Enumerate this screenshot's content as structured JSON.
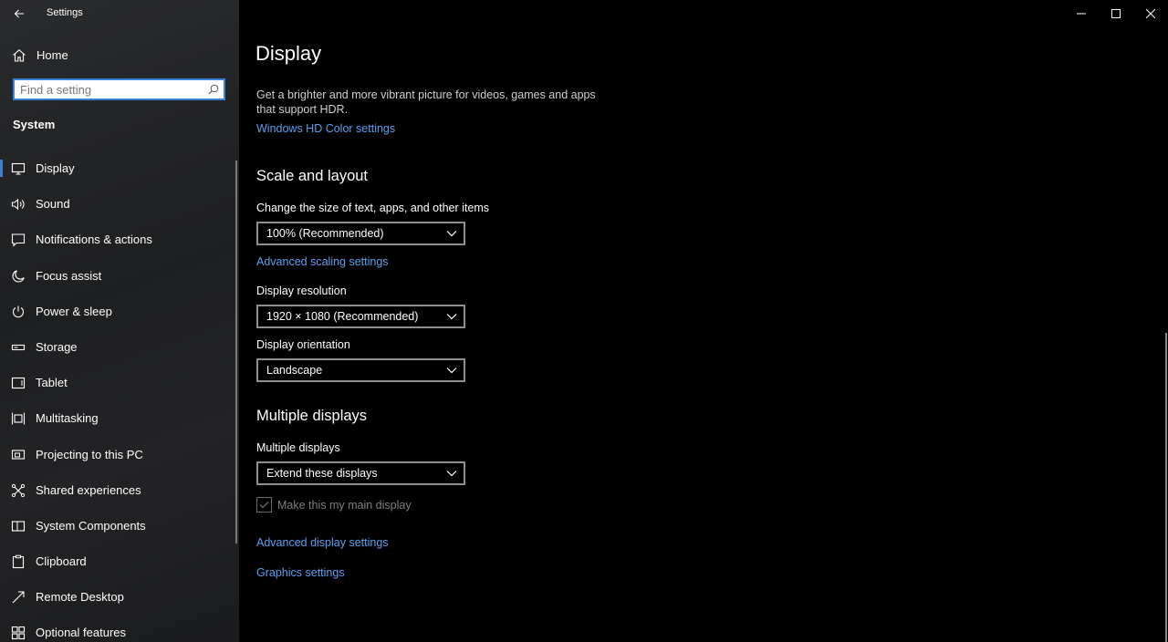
{
  "app_title": "Settings",
  "sidebar": {
    "home_label": "Home",
    "search_placeholder": "Find a setting",
    "section_heading": "System",
    "items": [
      {
        "label": "Display",
        "icon": "monitor-icon",
        "active": true
      },
      {
        "label": "Sound",
        "icon": "speaker-icon"
      },
      {
        "label": "Notifications & actions",
        "icon": "notification-icon"
      },
      {
        "label": "Focus assist",
        "icon": "moon-icon"
      },
      {
        "label": "Power & sleep",
        "icon": "power-icon"
      },
      {
        "label": "Storage",
        "icon": "storage-icon"
      },
      {
        "label": "Tablet",
        "icon": "tablet-icon"
      },
      {
        "label": "Multitasking",
        "icon": "multitasking-icon"
      },
      {
        "label": "Projecting to this PC",
        "icon": "projecting-icon"
      },
      {
        "label": "Shared experiences",
        "icon": "shared-experiences-icon"
      },
      {
        "label": "System Components",
        "icon": "system-components-icon"
      },
      {
        "label": "Clipboard",
        "icon": "clipboard-icon"
      },
      {
        "label": "Remote Desktop",
        "icon": "remote-desktop-icon"
      },
      {
        "label": "Optional features",
        "icon": "optional-features-icon"
      }
    ]
  },
  "main": {
    "title": "Display",
    "hdr_description": "Get a brighter and more vibrant picture for videos, games and apps that support HDR.",
    "hdr_link": "Windows HD Color settings",
    "scale_heading": "Scale and layout",
    "scale_label": "Change the size of text, apps, and other items",
    "scale_value": "100% (Recommended)",
    "advanced_scaling_link": "Advanced scaling settings",
    "resolution_label": "Display resolution",
    "resolution_value": "1920 × 1080 (Recommended)",
    "orientation_label": "Display orientation",
    "orientation_value": "Landscape",
    "multiple_heading": "Multiple displays",
    "multiple_label": "Multiple displays",
    "multiple_value": "Extend these displays",
    "main_display_checkbox": "Make this my main display",
    "main_display_checked": true,
    "advanced_display_link": "Advanced display settings",
    "graphics_link": "Graphics settings"
  },
  "colors": {
    "accent": "#3b82d6",
    "link": "#5aa0ef",
    "background": "#000000",
    "sidebar": "#232325"
  }
}
